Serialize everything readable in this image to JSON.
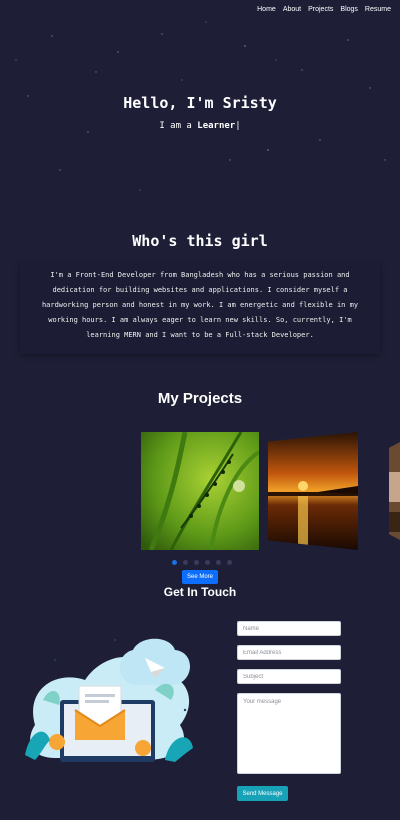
{
  "nav": {
    "items": [
      "Home",
      "About",
      "Projects",
      "Blogs",
      "Resume"
    ]
  },
  "hero": {
    "title": "Hello, I'm Sristy",
    "subtitle_prefix": "I am a ",
    "subtitle_role": "Learner",
    "caret": "|"
  },
  "about": {
    "title": "Who's this girl",
    "text": "I'm a Front-End Developer from Bangladesh who has a serious passion and dedication for building websites and applications. I consider myself a hardworking person and honest in my work. I am energetic and flexible in my working hours. I am always eager to learn new skills. So, currently, I'm learning MERN and I want to be a Full-stack Developer."
  },
  "projects": {
    "title": "My Projects",
    "slides": [
      "grass-slide",
      "sunset-slide",
      "partial-slide"
    ],
    "active_dot": 0,
    "dot_count": 6,
    "see_more_label": "See More"
  },
  "contact": {
    "title": "Get In Touch",
    "name_placeholder": "Name",
    "email_placeholder": "Email Address",
    "subject_placeholder": "Subject",
    "message_placeholder": "Your message",
    "send_label": "Send Message"
  },
  "colors": {
    "background": "#1e1f37",
    "primary_button": "#0d6efd",
    "send_button": "#17a2b8"
  }
}
